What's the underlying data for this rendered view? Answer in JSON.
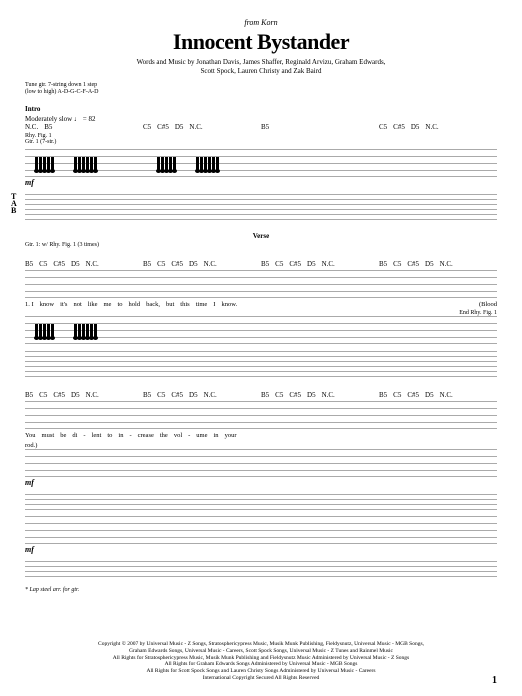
{
  "header": {
    "from": "from Korn",
    "title": "Innocent Bystander",
    "credits_line1": "Words and Music by Jonathan Davis, James Shaffer, Reginald Arvizu, Graham Edwards,",
    "credits_line2": "Scott Spock, Lauren Christy and Zak Baird"
  },
  "tuning": {
    "line1": "Tune gtr. 7-string down 1 step",
    "line2": "(low to high) A-D-G-C-F-A-D"
  },
  "intro": {
    "label": "Intro",
    "tempo": "Moderately slow ♩ = 82",
    "chords": [
      "N.C.",
      "B5",
      "C5",
      "C#5",
      "D5",
      "N.C.",
      "B5",
      "C5",
      "C#5",
      "D5",
      "N.C."
    ],
    "rhy_fig": "Rhy. Fig. 1",
    "tab_label_t": "T",
    "tab_label_a": "A",
    "tab_label_b": "B",
    "dynamics": "mf",
    "gtr_label": "Gtr. 1 (7-str.)"
  },
  "verse": {
    "label": "Verse",
    "gtr_note": "Gtr. 1: w/ Rhy. Fig. 1 (3 times)",
    "chords_sys1": [
      "B5",
      "C5",
      "C#5",
      "D5",
      "N.C.",
      "B5",
      "C5",
      "C#5",
      "D5",
      "N.C.",
      "B5",
      "C5",
      "C#5",
      "D5",
      "N.C.",
      "B5",
      "C5",
      "C#5",
      "D5",
      "N.C."
    ],
    "lyrics1": [
      "1. I",
      "know",
      "it's",
      "not",
      "like",
      "me",
      "to",
      "hold",
      "back,",
      "but",
      "this",
      "time",
      "I",
      "know."
    ],
    "lyrics1_alt": "(Blood",
    "end_rhy": "End Rhy. Fig. 1",
    "chords_sys2": [
      "B5",
      "C5",
      "C#5",
      "D5",
      "N.C.",
      "B5",
      "C5",
      "C#5",
      "D5",
      "N.C.",
      "B5",
      "C5",
      "C#5",
      "D5",
      "N.C.",
      "B5",
      "C5",
      "C#5",
      "D5",
      "N.C."
    ],
    "lyrics2": [
      "You",
      "must",
      "be",
      "di",
      "-",
      "lent",
      "to",
      "in",
      "-",
      "crease",
      "the",
      "vol",
      "-",
      "ume",
      "in",
      "your"
    ],
    "lyrics2_end": "rod.)",
    "dynamics2": "mf"
  },
  "footnote": "* Lap steel arr. for gtr.",
  "copyright": {
    "l1": "Copyright © 2007 by Universal Music - Z Songs, Stratosphericypress Music, Musik Munk Publishing, Fieldysnutz, Universal Music - MGB Songs,",
    "l2": "Graham Edwards Songs, Universal Music - Careers, Scott Spock Songs, Universal Music - Z Tunes and Rainmel Music",
    "l3": "All Rights for Stratosphericypress Music, Musik Munk Publishing and Fieldysnutz Music Administered by Universal Music - Z Songs",
    "l4": "All Rights for Graham Edwards Songs Administered by Universal Music - MGB Songs",
    "l5": "All Rights for Scott Spock Songs and Lauren Christy Songs Administered by Universal Music - Careers",
    "l6": "International Copyright Secured   All Rights Reserved"
  },
  "page": "1"
}
